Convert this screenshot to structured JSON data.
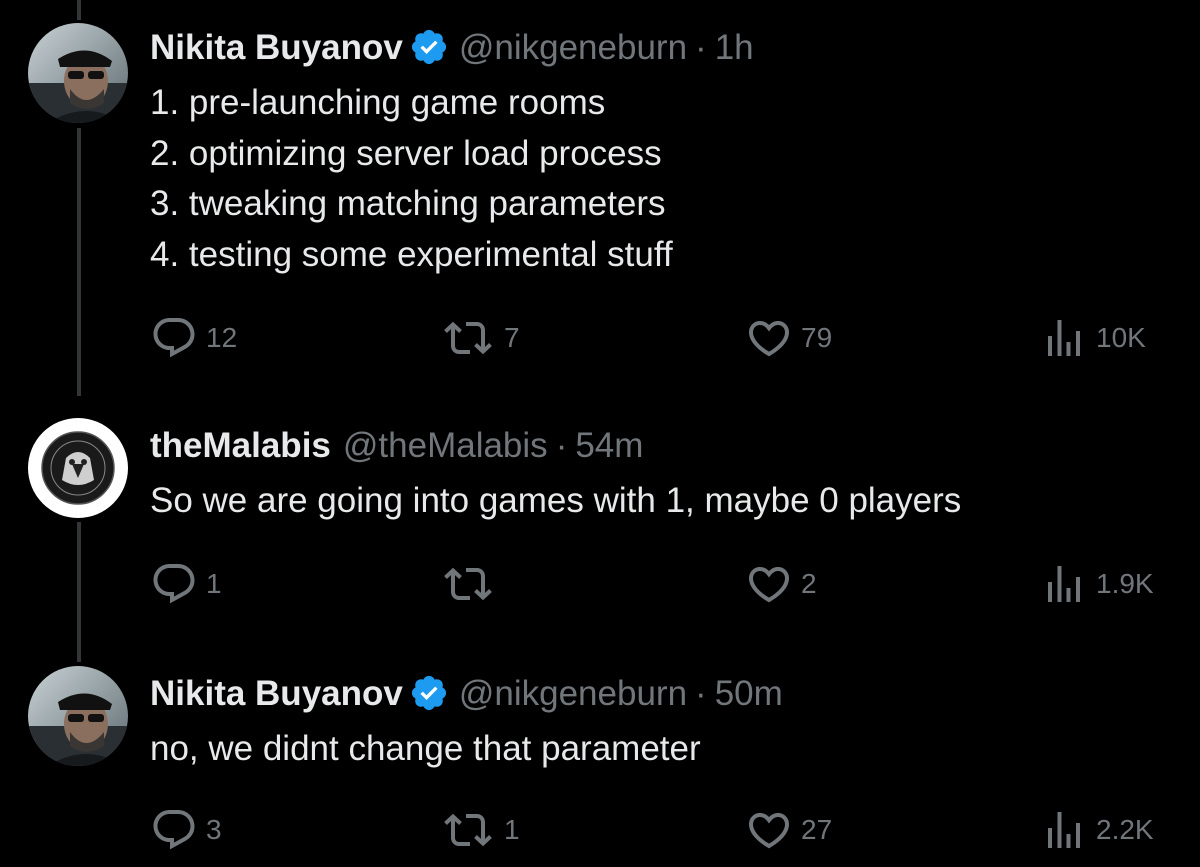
{
  "tweets": [
    {
      "name": "Nikita Buyanov",
      "verified": true,
      "handle": "@nikgeneburn",
      "separator": "·",
      "time": "1h",
      "lines": [
        "1. pre-launching game rooms",
        "2. optimizing server load process",
        "3. tweaking matching parameters",
        "4. testing some experimental stuff"
      ],
      "replies": "12",
      "retweets": "7",
      "likes": "79",
      "views": "10K"
    },
    {
      "name": "theMalabis",
      "verified": false,
      "handle": "@theMalabis",
      "separator": "·",
      "time": "54m",
      "lines": [
        "So we are going into games with 1, maybe 0 players"
      ],
      "replies": "1",
      "retweets": "",
      "likes": "2",
      "views": "1.9K"
    },
    {
      "name": "Nikita Buyanov",
      "verified": true,
      "handle": "@nikgeneburn",
      "separator": "·",
      "time": "50m",
      "lines": [
        "no, we didnt change that parameter"
      ],
      "replies": "3",
      "retweets": "1",
      "likes": "27",
      "views": "2.2K"
    }
  ],
  "colors": {
    "background": "#000000",
    "text": "#e7e9ea",
    "secondary": "#71767b",
    "verified": "#1d9bf0",
    "thread_line": "#333639"
  },
  "icons": {
    "reply": "reply-icon",
    "retweet": "retweet-icon",
    "like": "heart-icon",
    "views": "views-icon",
    "verified": "verified-badge-icon"
  }
}
